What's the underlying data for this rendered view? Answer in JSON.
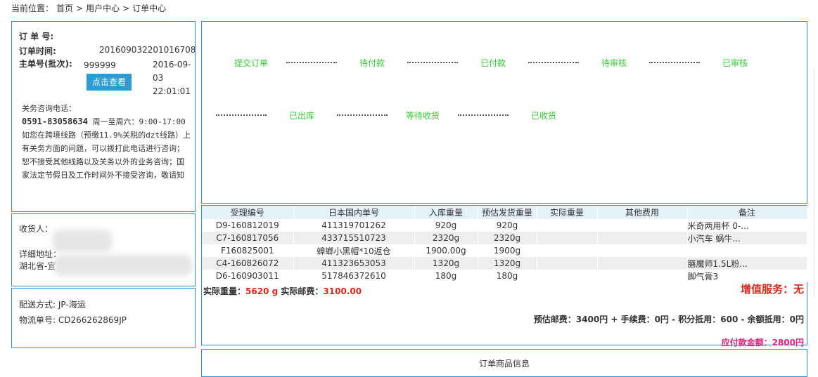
{
  "breadcrumb": {
    "prefix": "当前位置：",
    "home": "首页",
    "sep1": ">",
    "user_center": "用户中心",
    "sep2": ">",
    "current": "订单中心"
  },
  "order": {
    "order_no_label": "订 单 号:",
    "order_time_label": "订单时间:",
    "order_time_value": "201609032201016708",
    "main_no_label": "主单号(批次):",
    "main_no_value": "999999",
    "date_value": "2016-09-03 22:01:01",
    "view_button": "点击查看",
    "consult_title": "关务咨询电话：",
    "phone": "0591-83058634",
    "hours": "周一至周六：9:00-17:00",
    "notice": "如您在跨境线路（预缴11.9%关税的dzt线路）上有关务方面的问题，可以拨打此电话进行咨询；恕不接受其他线路以及关务以外的业务咨询；国家法定节假日及工作时间外不接受咨询，敬请知"
  },
  "status_steps": [
    "提交订单",
    "待付款",
    "已付款",
    "待审核",
    "已审核",
    "已出库",
    "等待收货",
    "已收货"
  ],
  "recipient": {
    "label": "收货人：",
    "address_label": "详细地址：",
    "province": "湖北省-宜"
  },
  "shipping": {
    "method": "配送方式: JP-海运",
    "tracking": "物流单号: CD266262869JP"
  },
  "table": {
    "headers": [
      "受理编号",
      "日本国内单号",
      "入库重量",
      "预估发货重量",
      "实际重量",
      "其他费用",
      "备注"
    ],
    "rows": [
      [
        "D9-160812019",
        "411319701262",
        "920g",
        "920g",
        "",
        "",
        "米奇两用杯  0-..."
      ],
      [
        "C7-160817056",
        "433715510723",
        "2320g",
        "2320g",
        "",
        "",
        "小汽车  蜗牛..."
      ],
      [
        "F160825001",
        "蟑螂小黑帽*10返仓",
        "1900.00g",
        "1900g",
        "",
        "",
        ""
      ],
      [
        "C4-160826072",
        "411323653053",
        "1320g",
        "1320g",
        "",
        "",
        "膳魔师1.5L粉..."
      ],
      [
        "D6-160903011",
        "517846372610",
        "180g",
        "180g",
        "",
        "",
        "脚气膏3"
      ]
    ]
  },
  "summary": {
    "actual_weight_label": "实际重量：",
    "actual_weight": "5620 g",
    "actual_postage_label": "实际邮费：",
    "actual_postage": "3100.00",
    "value_added": "增值服务：无",
    "estimate": "预估邮费：3400円 + 手续费：0円 - 积分抵用：600 - 余额抵用：0円",
    "payable": "应付款金额：2800円"
  },
  "goods": {
    "title": "订单商品信息"
  },
  "colors": {
    "border": "#2f8fd0",
    "step_green": "#33cc33",
    "accent_red": "#e0261c",
    "button_blue": "#2f9bd6"
  }
}
